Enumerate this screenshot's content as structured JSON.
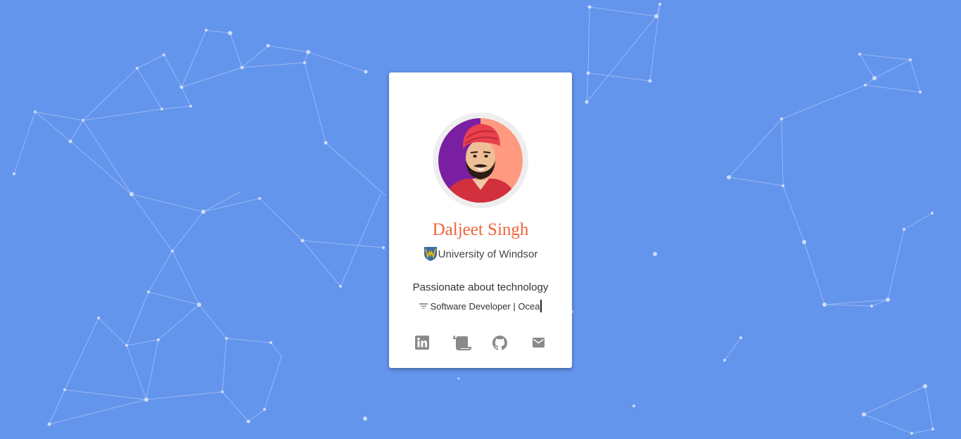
{
  "profile": {
    "name": "Daljeet Singh",
    "university": "University of Windsor",
    "tagline": "Passionate about technology",
    "typed_roles": "Software Developer | Ocea"
  },
  "social_links": [
    {
      "icon": "linkedin-icon"
    },
    {
      "icon": "resume-scroll-icon"
    },
    {
      "icon": "github-icon"
    },
    {
      "icon": "email-icon"
    }
  ],
  "colors": {
    "background": "#6495ed",
    "card": "#ffffff",
    "name": "#f0643a",
    "icon": "#8a8a8a",
    "network_lines": "#a9c3f5"
  }
}
